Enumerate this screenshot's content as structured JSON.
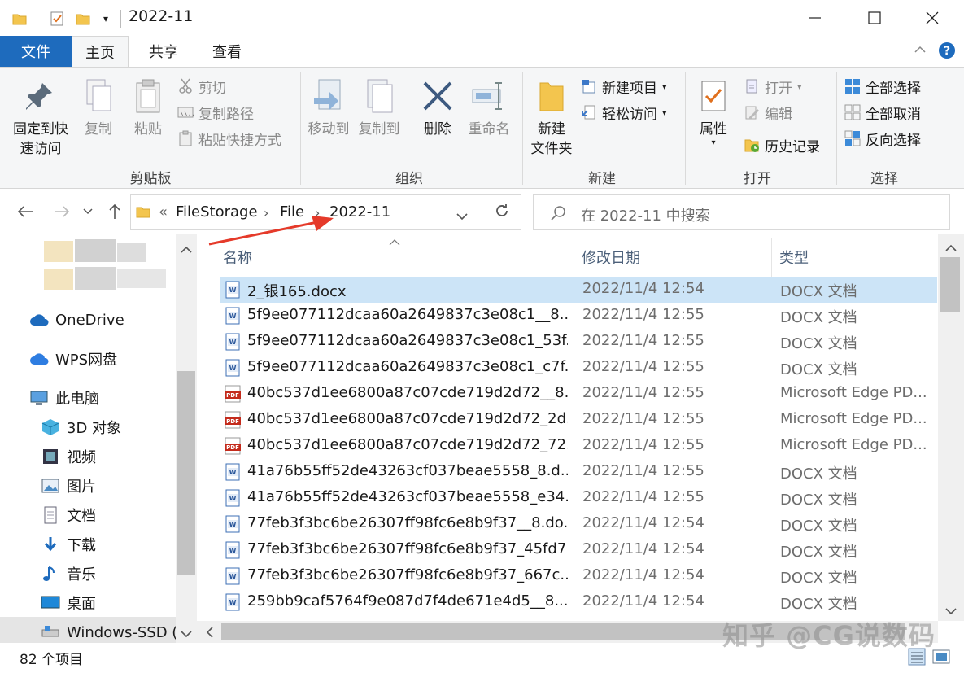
{
  "window": {
    "title": "2022-11"
  },
  "tabs": {
    "file": "文件",
    "home": "主页",
    "share": "共享",
    "view": "查看"
  },
  "ribbon": {
    "clipboard": {
      "pin_line1": "固定到快",
      "pin_line2": "速访问",
      "copy": "复制",
      "paste": "粘贴",
      "cut": "剪切",
      "copy_path": "复制路径",
      "paste_shortcut": "粘贴快捷方式",
      "label": "剪贴板"
    },
    "organize": {
      "move_to": "移动到",
      "copy_to": "复制到",
      "delete": "删除",
      "rename": "重命名",
      "label": "组织"
    },
    "new": {
      "new_folder_line1": "新建",
      "new_folder_line2": "文件夹",
      "new_item": "新建项目",
      "easy_access": "轻松访问",
      "label": "新建"
    },
    "open": {
      "properties": "属性",
      "open": "打开",
      "edit": "编辑",
      "history": "历史记录",
      "label": "打开"
    },
    "select": {
      "select_all": "全部选择",
      "select_none": "全部取消",
      "invert": "反向选择",
      "label": "选择"
    }
  },
  "address": {
    "overflow": "«",
    "crumbs": [
      "FileStorage",
      "File",
      "2022-11"
    ]
  },
  "search": {
    "placeholder": "在 2022-11 中搜索"
  },
  "nav": {
    "onedrive": "OneDrive",
    "wps": "WPS网盘",
    "this_pc": "此电脑",
    "objects3d": "3D 对象",
    "videos": "视频",
    "pictures": "图片",
    "documents": "文档",
    "downloads": "下载",
    "music": "音乐",
    "desktop": "桌面",
    "drive": "Windows-SSD (C"
  },
  "columns": {
    "name": "名称",
    "date": "修改日期",
    "type": "类型"
  },
  "files": [
    {
      "name": "2_银165.docx",
      "date": "2022/11/4 12:54",
      "type": "DOCX 文档",
      "kind": "docx",
      "selected": true
    },
    {
      "name": "5f9ee077112dcaa60a2649837c3e08c1__8....",
      "date": "2022/11/4 12:55",
      "type": "DOCX 文档",
      "kind": "docx"
    },
    {
      "name": "5f9ee077112dcaa60a2649837c3e08c1_53f...",
      "date": "2022/11/4 12:55",
      "type": "DOCX 文档",
      "kind": "docx"
    },
    {
      "name": "5f9ee077112dcaa60a2649837c3e08c1_c7f...",
      "date": "2022/11/4 12:55",
      "type": "DOCX 文档",
      "kind": "docx"
    },
    {
      "name": "40bc537d1ee6800a87c07cde719d2d72__8....",
      "date": "2022/11/4 12:55",
      "type": "Microsoft Edge PD...",
      "kind": "pdf"
    },
    {
      "name": "40bc537d1ee6800a87c07cde719d2d72_2d...",
      "date": "2022/11/4 12:55",
      "type": "Microsoft Edge PD...",
      "kind": "pdf"
    },
    {
      "name": "40bc537d1ee6800a87c07cde719d2d72_72...",
      "date": "2022/11/4 12:55",
      "type": "Microsoft Edge PD...",
      "kind": "pdf"
    },
    {
      "name": "41a76b55ff52de43263cf037beae5558_8.d...",
      "date": "2022/11/4 12:55",
      "type": "DOCX 文档",
      "kind": "docx"
    },
    {
      "name": "41a76b55ff52de43263cf037beae5558_e34...",
      "date": "2022/11/4 12:55",
      "type": "DOCX 文档",
      "kind": "docx"
    },
    {
      "name": "77feb3f3bc6be26307ff98fc6e8b9f37__8.do...",
      "date": "2022/11/4 12:54",
      "type": "DOCX 文档",
      "kind": "docx"
    },
    {
      "name": "77feb3f3bc6be26307ff98fc6e8b9f37_45fd7...",
      "date": "2022/11/4 12:54",
      "type": "DOCX 文档",
      "kind": "docx"
    },
    {
      "name": "77feb3f3bc6be26307ff98fc6e8b9f37_667c...",
      "date": "2022/11/4 12:54",
      "type": "DOCX 文档",
      "kind": "docx"
    },
    {
      "name": "259bb9caf5764f9e087d7f4de671e4d5__8....",
      "date": "2022/11/4 12:54",
      "type": "DOCX 文档",
      "kind": "docx"
    }
  ],
  "status": {
    "count": "82 个项目"
  },
  "watermark": "知乎 @CG说数码",
  "colors": {
    "accent": "#1e6bbd",
    "selection": "#cce4f7",
    "arrow": "#e53a2a",
    "pdf": "#c42b1c",
    "folder": "#f3c54e"
  }
}
